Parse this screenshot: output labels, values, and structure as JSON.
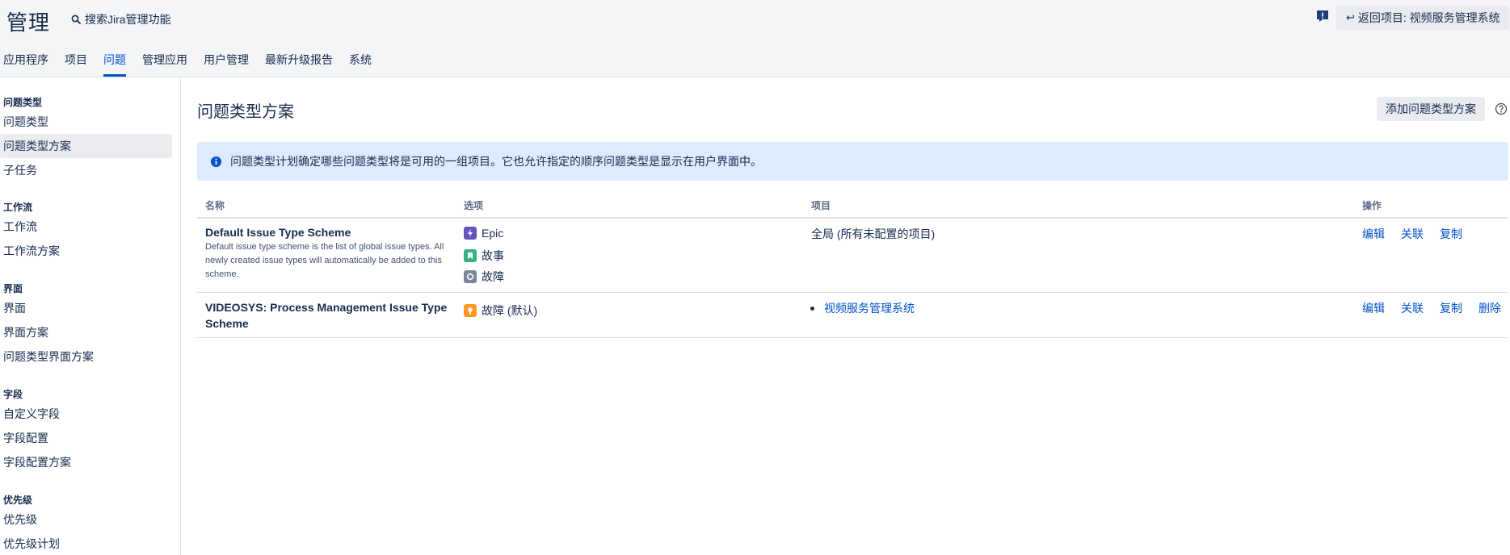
{
  "header": {
    "title": "管理",
    "search_label": "搜索Jira管理功能",
    "back_button": "返回项目: 视频服务管理系统",
    "colors": {
      "accent": "#0052cc",
      "feedback": "#1d3e74"
    }
  },
  "tabs": [
    {
      "label": "应用程序"
    },
    {
      "label": "项目"
    },
    {
      "label": "问题",
      "active": true
    },
    {
      "label": "管理应用"
    },
    {
      "label": "用户管理"
    },
    {
      "label": "最新升级报告"
    },
    {
      "label": "系统"
    }
  ],
  "sidebar": {
    "groups": [
      {
        "title": "问题类型",
        "items": [
          "问题类型",
          "问题类型方案",
          "子任务"
        ]
      },
      {
        "title": "工作流",
        "items": [
          "工作流",
          "工作流方案"
        ]
      },
      {
        "title": "界面",
        "items": [
          "界面",
          "界面方案",
          "问题类型界面方案"
        ]
      },
      {
        "title": "字段",
        "items": [
          "自定义字段",
          "字段配置",
          "字段配置方案"
        ]
      },
      {
        "title": "优先级",
        "items": [
          "优先级",
          "优先级计划"
        ]
      }
    ],
    "active_item": "问题类型方案"
  },
  "main": {
    "title": "问题类型方案",
    "add_button": "添加问题类型方案",
    "info": "问题类型计划确定哪些问题类型将是可用的一组项目。它也允许指定的顺序问题类型是显示在用户界面中。",
    "columns": [
      "名称",
      "选项",
      "项目",
      "操作"
    ],
    "rows": [
      {
        "name": "Default Issue Type Scheme",
        "description": "Default issue type scheme is the list of global issue types. All newly created issue types will automatically be added to this scheme.",
        "options": [
          {
            "label": "Epic",
            "icon": "epic-icon",
            "color": "#6554c0"
          },
          {
            "label": "故事",
            "icon": "story-icon",
            "color": "#36b37e"
          },
          {
            "label": "故障",
            "icon": "bug-icon",
            "color": "#7a869a"
          }
        ],
        "project": "全局 (所有未配置的项目)",
        "ops": [
          "编辑",
          "关联",
          "复制"
        ]
      },
      {
        "name": "VIDEOSYS: Process Management Issue Type Scheme",
        "options": [
          {
            "label": "故障 (默认)",
            "icon": "bug-icon",
            "color": "#ff991f"
          }
        ],
        "project_link": "视频服务管理系统",
        "ops": [
          "编辑",
          "关联",
          "复制",
          "删除"
        ]
      }
    ]
  }
}
